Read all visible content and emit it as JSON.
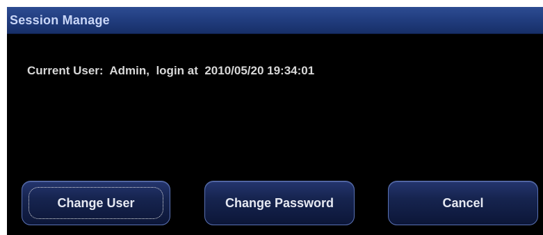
{
  "dialog": {
    "title": "Session Manage",
    "info": "Current User:  Admin,  login at  2010/05/20 19:34:01"
  },
  "buttons": {
    "change_user": "Change User",
    "change_password": "Change Password",
    "cancel": "Cancel",
    "focused": "change_user"
  },
  "colors": {
    "title_bar": "#223e80",
    "title_text": "#c9d6f7",
    "background": "#000000",
    "button_fill": "#16244f",
    "button_border": "#5a72b4"
  }
}
